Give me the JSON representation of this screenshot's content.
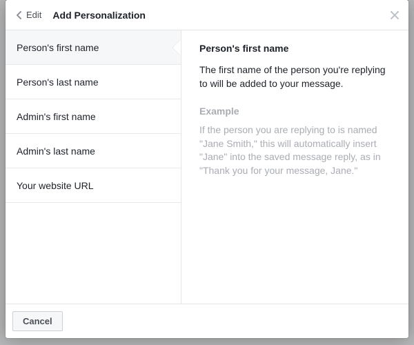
{
  "header": {
    "back_label": "Edit",
    "title": "Add Personalization"
  },
  "list": {
    "items": [
      {
        "label": "Person's first name",
        "selected": true
      },
      {
        "label": "Person's last name",
        "selected": false
      },
      {
        "label": "Admin's first name",
        "selected": false
      },
      {
        "label": "Admin's last name",
        "selected": false
      },
      {
        "label": "Your website URL",
        "selected": false
      }
    ]
  },
  "detail": {
    "title": "Person's first name",
    "description": "The first name of the person you're replying to will be added to your message.",
    "example_label": "Example",
    "example_text": "If the person you are replying to is named \"Jane Smith,\" this will automatically insert \"Jane\" into the saved message reply, as in \"Thank you for your message, Jane.\""
  },
  "footer": {
    "cancel_label": "Cancel"
  }
}
